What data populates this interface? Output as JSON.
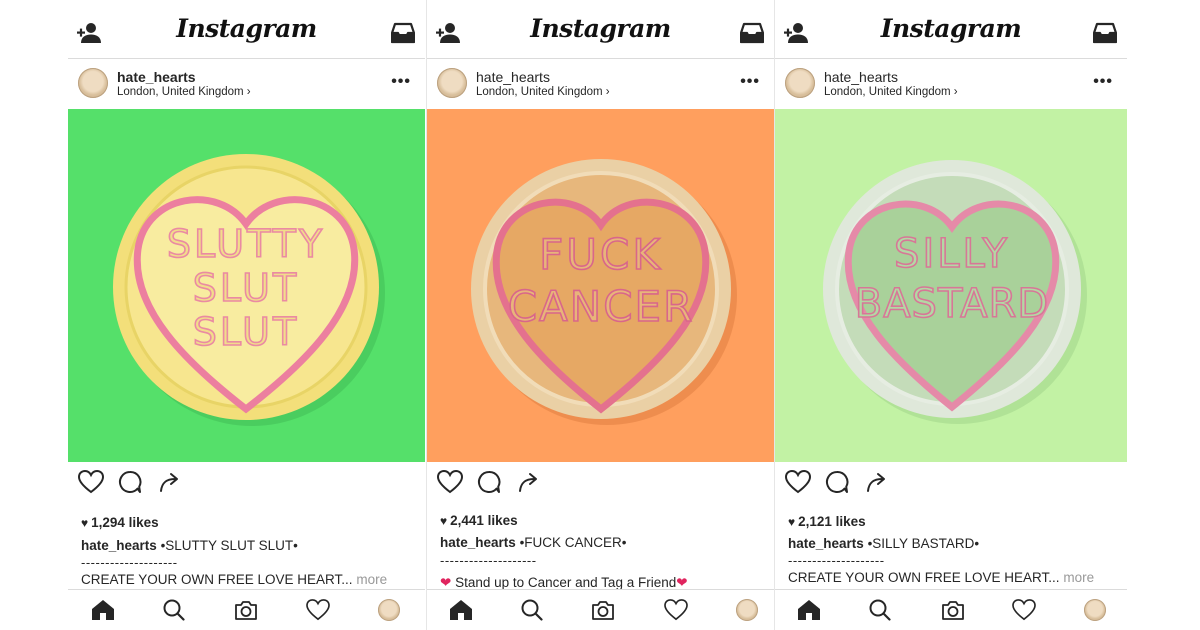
{
  "app": {
    "title": "Instagram"
  },
  "posts": [
    {
      "user": "hate_hearts",
      "location": "London, United Kingdom ›",
      "photo": {
        "bg": "#55e06a",
        "candy": "#f4e27c",
        "rim": "#f0d75a",
        "heart": "#f7e58a",
        "words": [
          "SLUTTY",
          "SLUT",
          "SLUT"
        ]
      },
      "likes": "1,294 likes",
      "caption_text": "•SLUTTY SLUT SLUT•",
      "dashes": "--------------------",
      "line3": "CREATE YOUR OWN FREE LOVE HEART...",
      "more": "more"
    },
    {
      "user": "hate_hearts",
      "location": "London, United Kingdom ›",
      "photo": {
        "bg": "#ff9f5e",
        "candy": "#e8b87a",
        "rim": "#e9c48e",
        "heart": "#e8ad6a",
        "words": [
          "FUCK",
          "CANCER"
        ]
      },
      "likes": "2,441 likes",
      "caption_text": "•FUCK CANCER•",
      "dashes": "--------------------",
      "line3": "Stand up to Cancer and Tag a Friend",
      "more": ""
    },
    {
      "user": "hate_hearts",
      "location": "London, United Kingdom ›",
      "photo": {
        "bg": "#c2f2a4",
        "candy": "#c9dcc0",
        "rim": "#d5e2cd",
        "heart": "#a8cf98",
        "words": [
          "SILLY",
          "BASTARD"
        ]
      },
      "likes": "2,121 likes",
      "caption_text": "•SILLY BASTARD•",
      "dashes": "--------------------",
      "line3": "CREATE YOUR OWN FREE LOVE HEART...",
      "more": "more"
    }
  ]
}
